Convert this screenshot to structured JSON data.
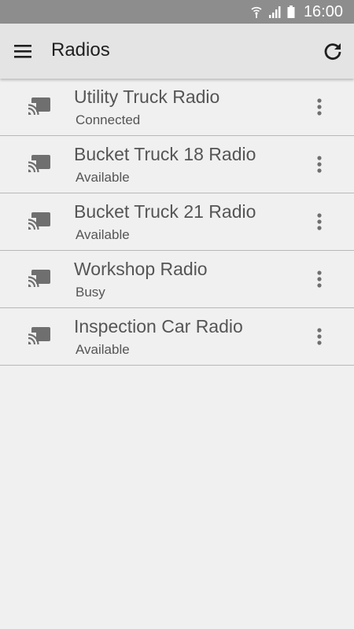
{
  "status_bar": {
    "time": "16:00",
    "icons": [
      "wifi-icon",
      "signal-icon",
      "battery-icon"
    ]
  },
  "app_bar": {
    "title": "Radios",
    "menu_icon": "hamburger-menu-icon",
    "refresh_icon": "refresh-icon"
  },
  "radios": [
    {
      "name": "Utility Truck Radio",
      "status": "Connected"
    },
    {
      "name": "Bucket Truck 18 Radio",
      "status": "Available"
    },
    {
      "name": "Bucket Truck 21 Radio",
      "status": "Available"
    },
    {
      "name": "Workshop Radio",
      "status": "Busy"
    },
    {
      "name": "Inspection Car Radio",
      "status": "Available"
    }
  ],
  "row_icon": "cast-icon",
  "row_menu_icon": "more-vert-icon",
  "colors": {
    "status_bar": "#8d8d8d",
    "app_bar": "#e4e4e4",
    "background": "#f0f0f0",
    "icon_gray": "#6f6f6f"
  }
}
